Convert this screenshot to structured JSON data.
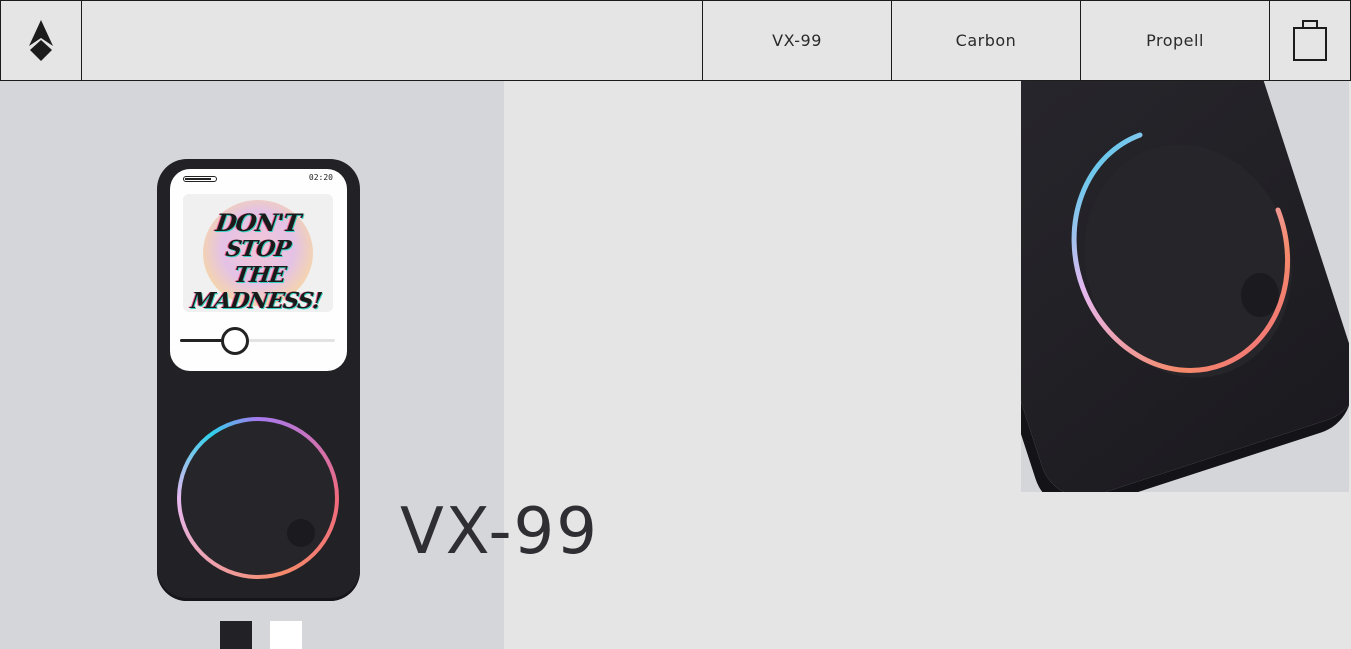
{
  "header": {
    "logo_icon": "spade-arrow-logo",
    "nav": [
      {
        "label": "VX-99"
      },
      {
        "label": "Carbon"
      },
      {
        "label": "Propell"
      }
    ],
    "cart_icon": "shopping-bag-icon"
  },
  "product": {
    "title": "VX-99",
    "screen": {
      "time": "02:20",
      "album_lines": [
        "DON'T",
        "STOP",
        "THE MADNESS!"
      ],
      "progress": 0.35
    },
    "color_options": [
      {
        "name": "black",
        "color": "#222126",
        "selected": true
      },
      {
        "name": "white",
        "color": "#ffffff",
        "selected": false
      }
    ]
  },
  "colors": {
    "background": "#e5e5e5",
    "panel": "#d5d6da",
    "device": "#222126",
    "accent_gradient": [
      "#2fd1ea",
      "#a77af0",
      "#f06a7e",
      "#f58a6a"
    ]
  }
}
